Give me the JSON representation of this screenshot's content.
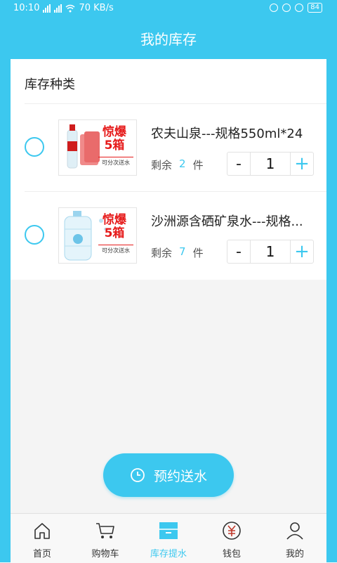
{
  "status_bar": {
    "time": "10:10",
    "network": "70 KB/s",
    "battery": "84"
  },
  "header": {
    "title": "我的库存"
  },
  "inventory": {
    "section_title": "库存种类",
    "items": [
      {
        "name": "农夫山泉---规格550ml*24",
        "remaining_label": "剩余",
        "remaining_count": "2",
        "unit": "件",
        "quantity": "1",
        "promo_line1": "惊爆",
        "promo_line2": "5箱",
        "promo_note": "可分次送水",
        "selected": false
      },
      {
        "name": "沙洲源含硒矿泉水---规格...",
        "remaining_label": "剩余",
        "remaining_count": "7",
        "unit": "件",
        "quantity": "1",
        "promo_line1": "惊爆",
        "promo_line2": "5箱",
        "promo_note": "可分次送水",
        "selected": false
      }
    ],
    "minus_label": "-",
    "plus_label": "+"
  },
  "action": {
    "book_label": "预约送水",
    "icon": "clock-icon"
  },
  "tabs": [
    {
      "label": "首页",
      "icon": "home-icon",
      "active": false
    },
    {
      "label": "购物车",
      "icon": "cart-icon",
      "active": false
    },
    {
      "label": "库存提水",
      "icon": "inventory-icon",
      "active": true
    },
    {
      "label": "钱包",
      "icon": "wallet-icon",
      "active": false
    },
    {
      "label": "我的",
      "icon": "user-icon",
      "active": false
    }
  ],
  "colors": {
    "accent": "#3cc8ef",
    "promo": "#e61b1b",
    "background": "#f4f4f4"
  }
}
